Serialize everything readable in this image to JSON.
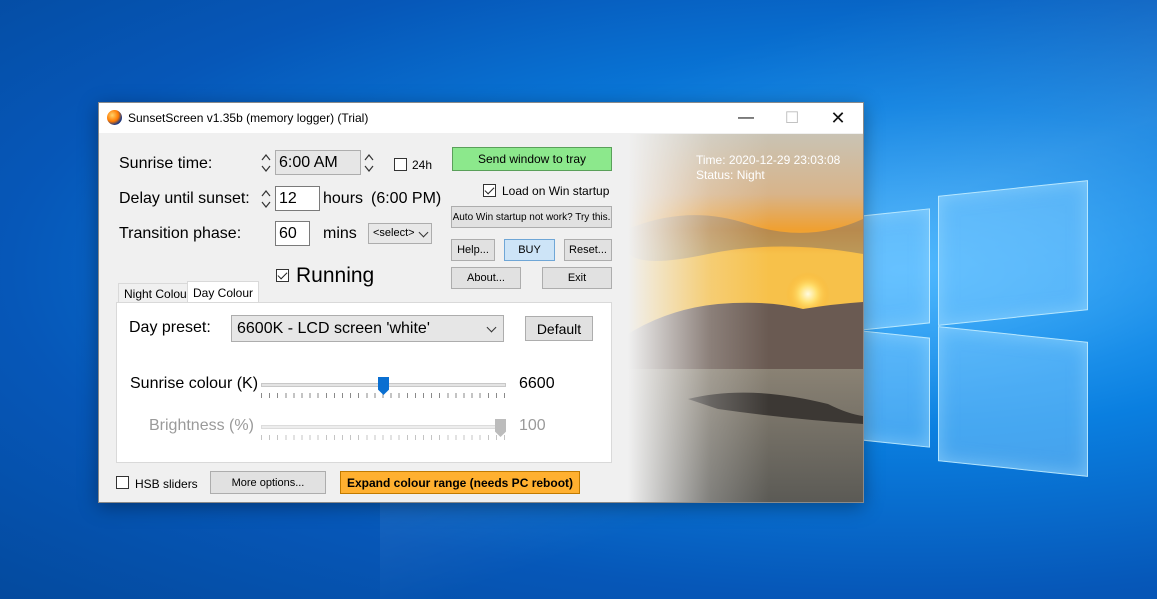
{
  "window": {
    "title": "SunsetScreen v1.35b (memory logger) (Trial)",
    "minimize_glyph": "—",
    "maximize_glyph": "☐",
    "close_glyph": "✕"
  },
  "settings": {
    "sunrise_label": "Sunrise time:",
    "sunrise_value": "6:00 AM",
    "h24_label": "24h",
    "h24_checked": false,
    "delay_label": "Delay until sunset:",
    "delay_value": "12",
    "delay_unit": "hours",
    "delay_sunset_time": "(6:00 PM)",
    "transition_label": "Transition phase:",
    "transition_value": "60",
    "transition_unit": "mins",
    "transition_select": "<select>",
    "running_label": "Running",
    "running_checked": true
  },
  "buttons": {
    "send_to_tray": "Send window to tray",
    "load_on_startup": "Load on Win startup",
    "load_on_startup_checked": true,
    "auto_startup": "Auto Win startup not work? Try this.",
    "help": "Help...",
    "buy": "BUY",
    "reset": "Reset...",
    "about": "About...",
    "exit": "Exit"
  },
  "tabs": [
    {
      "label": "Night Colour",
      "active": false
    },
    {
      "label": "Day Colour",
      "active": true
    }
  ],
  "day_panel": {
    "preset_label": "Day preset:",
    "preset_value": "6600K - LCD screen 'white'",
    "default_button": "Default",
    "sunrise_colour_label": "Sunrise colour (K)",
    "sunrise_colour_value": "6600",
    "sunrise_colour_fraction": 0.5,
    "brightness_label": "Brightness (%)",
    "brightness_value": "100",
    "brightness_fraction": 1.0
  },
  "footer": {
    "hsb_label": "HSB sliders",
    "hsb_checked": false,
    "more_options": "More options...",
    "expand_colour": "Expand colour range (needs PC reboot)"
  },
  "status": {
    "time": "Time: 2020-12-29 23:03:08",
    "status": "Status: Night"
  },
  "colors": {
    "green_button": "#8ce88c",
    "orange_button": "#ffb030",
    "slider_thumb": "#0a6fd1"
  }
}
